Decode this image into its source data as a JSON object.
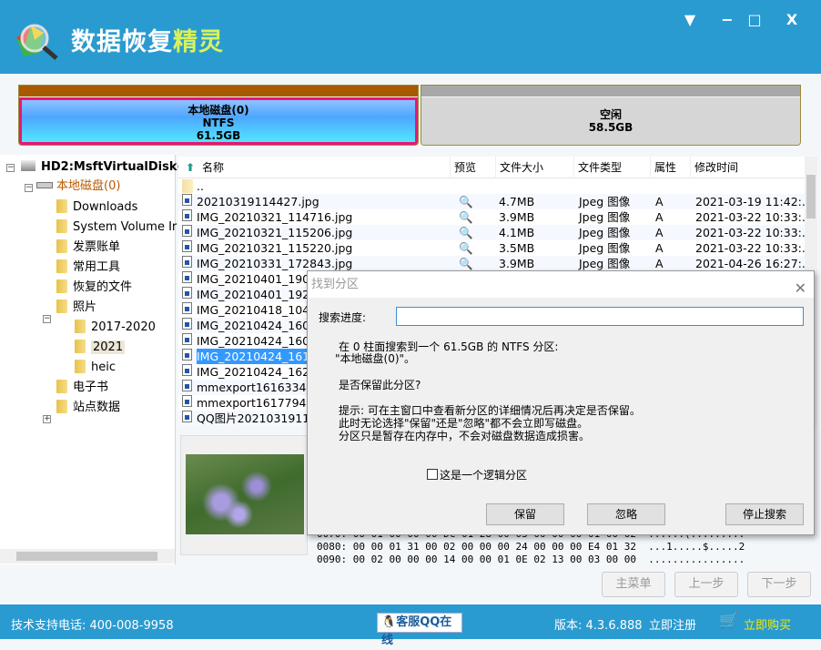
{
  "app": {
    "title_part1": "数据恢复",
    "title_part2": "精灵"
  },
  "window_controls": {
    "menu": "▼",
    "minimize": "−",
    "maximize": "□",
    "close": "X"
  },
  "disk_map": {
    "partitions": [
      {
        "name": "本地磁盘(0)",
        "fs": "NTFS",
        "size": "61.5GB",
        "selected": true
      },
      {
        "name": "空闲",
        "size": "58.5GB"
      }
    ]
  },
  "tree": {
    "disk": "HD2:MsftVirtualDisk(1",
    "partition": "本地磁盘(0)",
    "folders": [
      "Downloads",
      "System Volume Ir",
      "发票账单",
      "常用工具",
      "恢复的文件",
      "照片",
      "2017-2020",
      "2021",
      "heic",
      "电子书",
      "站点数据"
    ],
    "selected": "2021"
  },
  "filelist": {
    "columns": [
      "名称",
      "预览",
      "文件大小",
      "文件类型",
      "属性",
      "修改时间"
    ],
    "rows": [
      {
        "name": "..",
        "preview": "",
        "size": "",
        "type": "",
        "attr": "",
        "mtime": ""
      },
      {
        "name": "20210319114427.jpg",
        "preview": "🔍",
        "size": "4.7MB",
        "type": "Jpeg 图像",
        "attr": "A",
        "mtime": "2021-03-19 11:42:..."
      },
      {
        "name": "IMG_20210321_114716.jpg",
        "preview": "🔍",
        "size": "3.9MB",
        "type": "Jpeg 图像",
        "attr": "A",
        "mtime": "2021-03-22 10:33:..."
      },
      {
        "name": "IMG_20210321_115206.jpg",
        "preview": "🔍",
        "size": "4.1MB",
        "type": "Jpeg 图像",
        "attr": "A",
        "mtime": "2021-03-22 10:33:..."
      },
      {
        "name": "IMG_20210321_115220.jpg",
        "preview": "🔍",
        "size": "3.5MB",
        "type": "Jpeg 图像",
        "attr": "A",
        "mtime": "2021-03-22 10:33:..."
      },
      {
        "name": "IMG_20210331_172843.jpg",
        "preview": "🔍",
        "size": "3.9MB",
        "type": "Jpeg 图像",
        "attr": "A",
        "mtime": "2021-04-26 16:27:..."
      },
      {
        "name": "IMG_20210401_1904"
      },
      {
        "name": "IMG_20210401_1927"
      },
      {
        "name": "IMG_20210418_1049"
      },
      {
        "name": "IMG_20210424_1609"
      },
      {
        "name": "IMG_20210424_1609"
      },
      {
        "name": "IMG_20210424_1612",
        "selected": true
      },
      {
        "name": "IMG_20210424_1621"
      },
      {
        "name": "mmexport161633490"
      },
      {
        "name": "mmexport161779438"
      },
      {
        "name": "QQ图片20210319114"
      }
    ]
  },
  "hex": [
    "0070: 00 01 00 00 00 DC 01 28 00 03 00 00 00 01 00 02  ......(.........",
    "0080: 00 00 01 31 00 02 00 00 00 24 00 00 00 E4 01 32  ...1.....$.....2",
    "0090: 00 02 00 00 00 14 00 00 01 0E 02 13 00 03 00 00  ................"
  ],
  "nav": {
    "main_menu": "主菜单",
    "prev": "上一步",
    "next": "下一步"
  },
  "footer": {
    "support": "技术支持电话: 400-008-9958",
    "qq": "客服QQ在线",
    "version": "版本: 4.3.6.888",
    "register": "立即注册",
    "buy": "立即购买"
  },
  "dialog": {
    "title": "找到分区",
    "progress_label": "搜索进度:",
    "progress_value": "",
    "line1": "在 0 柱面搜索到一个 61.5GB 的 NTFS 分区:",
    "line2": "\"本地磁盘(0)\"。",
    "question": "是否保留此分区?",
    "hint1": "提示: 可在主窗口中查看新分区的详细情况后再决定是否保留。",
    "hint2": "此时无论选择\"保留\"还是\"忽略\"都不会立即写磁盘。",
    "hint3": "分区只是暂存在内存中，不会对磁盘数据造成损害。",
    "checkbox_label": "这是一个逻辑分区",
    "checkbox_checked": false,
    "keep": "保留",
    "ignore": "忽略",
    "stop": "停止搜索"
  },
  "colors": {
    "accent": "#2a9bd0",
    "selection": "#3399ff",
    "partition_border": "#e8157a"
  }
}
